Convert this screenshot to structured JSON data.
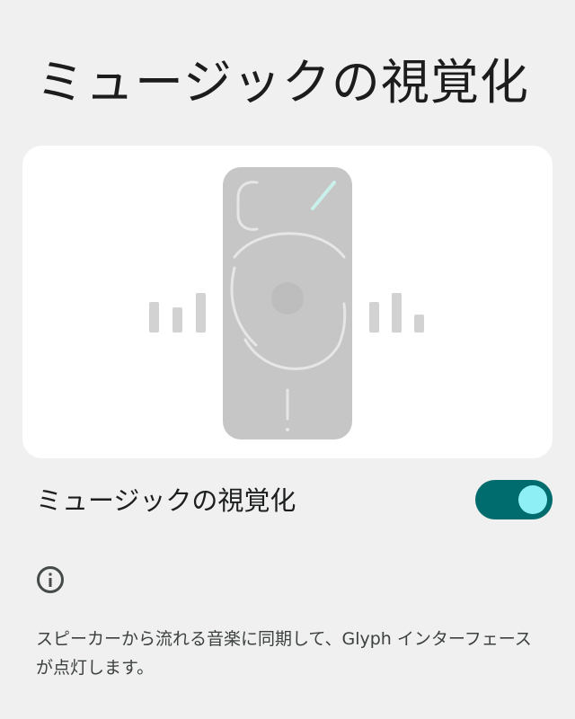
{
  "page": {
    "title": "ミュージックの視覚化"
  },
  "preview": {
    "illustration": "phone-glyph-illustration",
    "accent_color": "#c9f0ea"
  },
  "setting": {
    "label": "ミュージックの視覚化",
    "toggle_on": true,
    "toggle_track_color": "#006c6e",
    "toggle_thumb_color": "#8ef0f4"
  },
  "info": {
    "icon": "info-icon",
    "description": "スピーカーから流れる音楽に同期して、Glyph インターフェースが点灯します。"
  }
}
